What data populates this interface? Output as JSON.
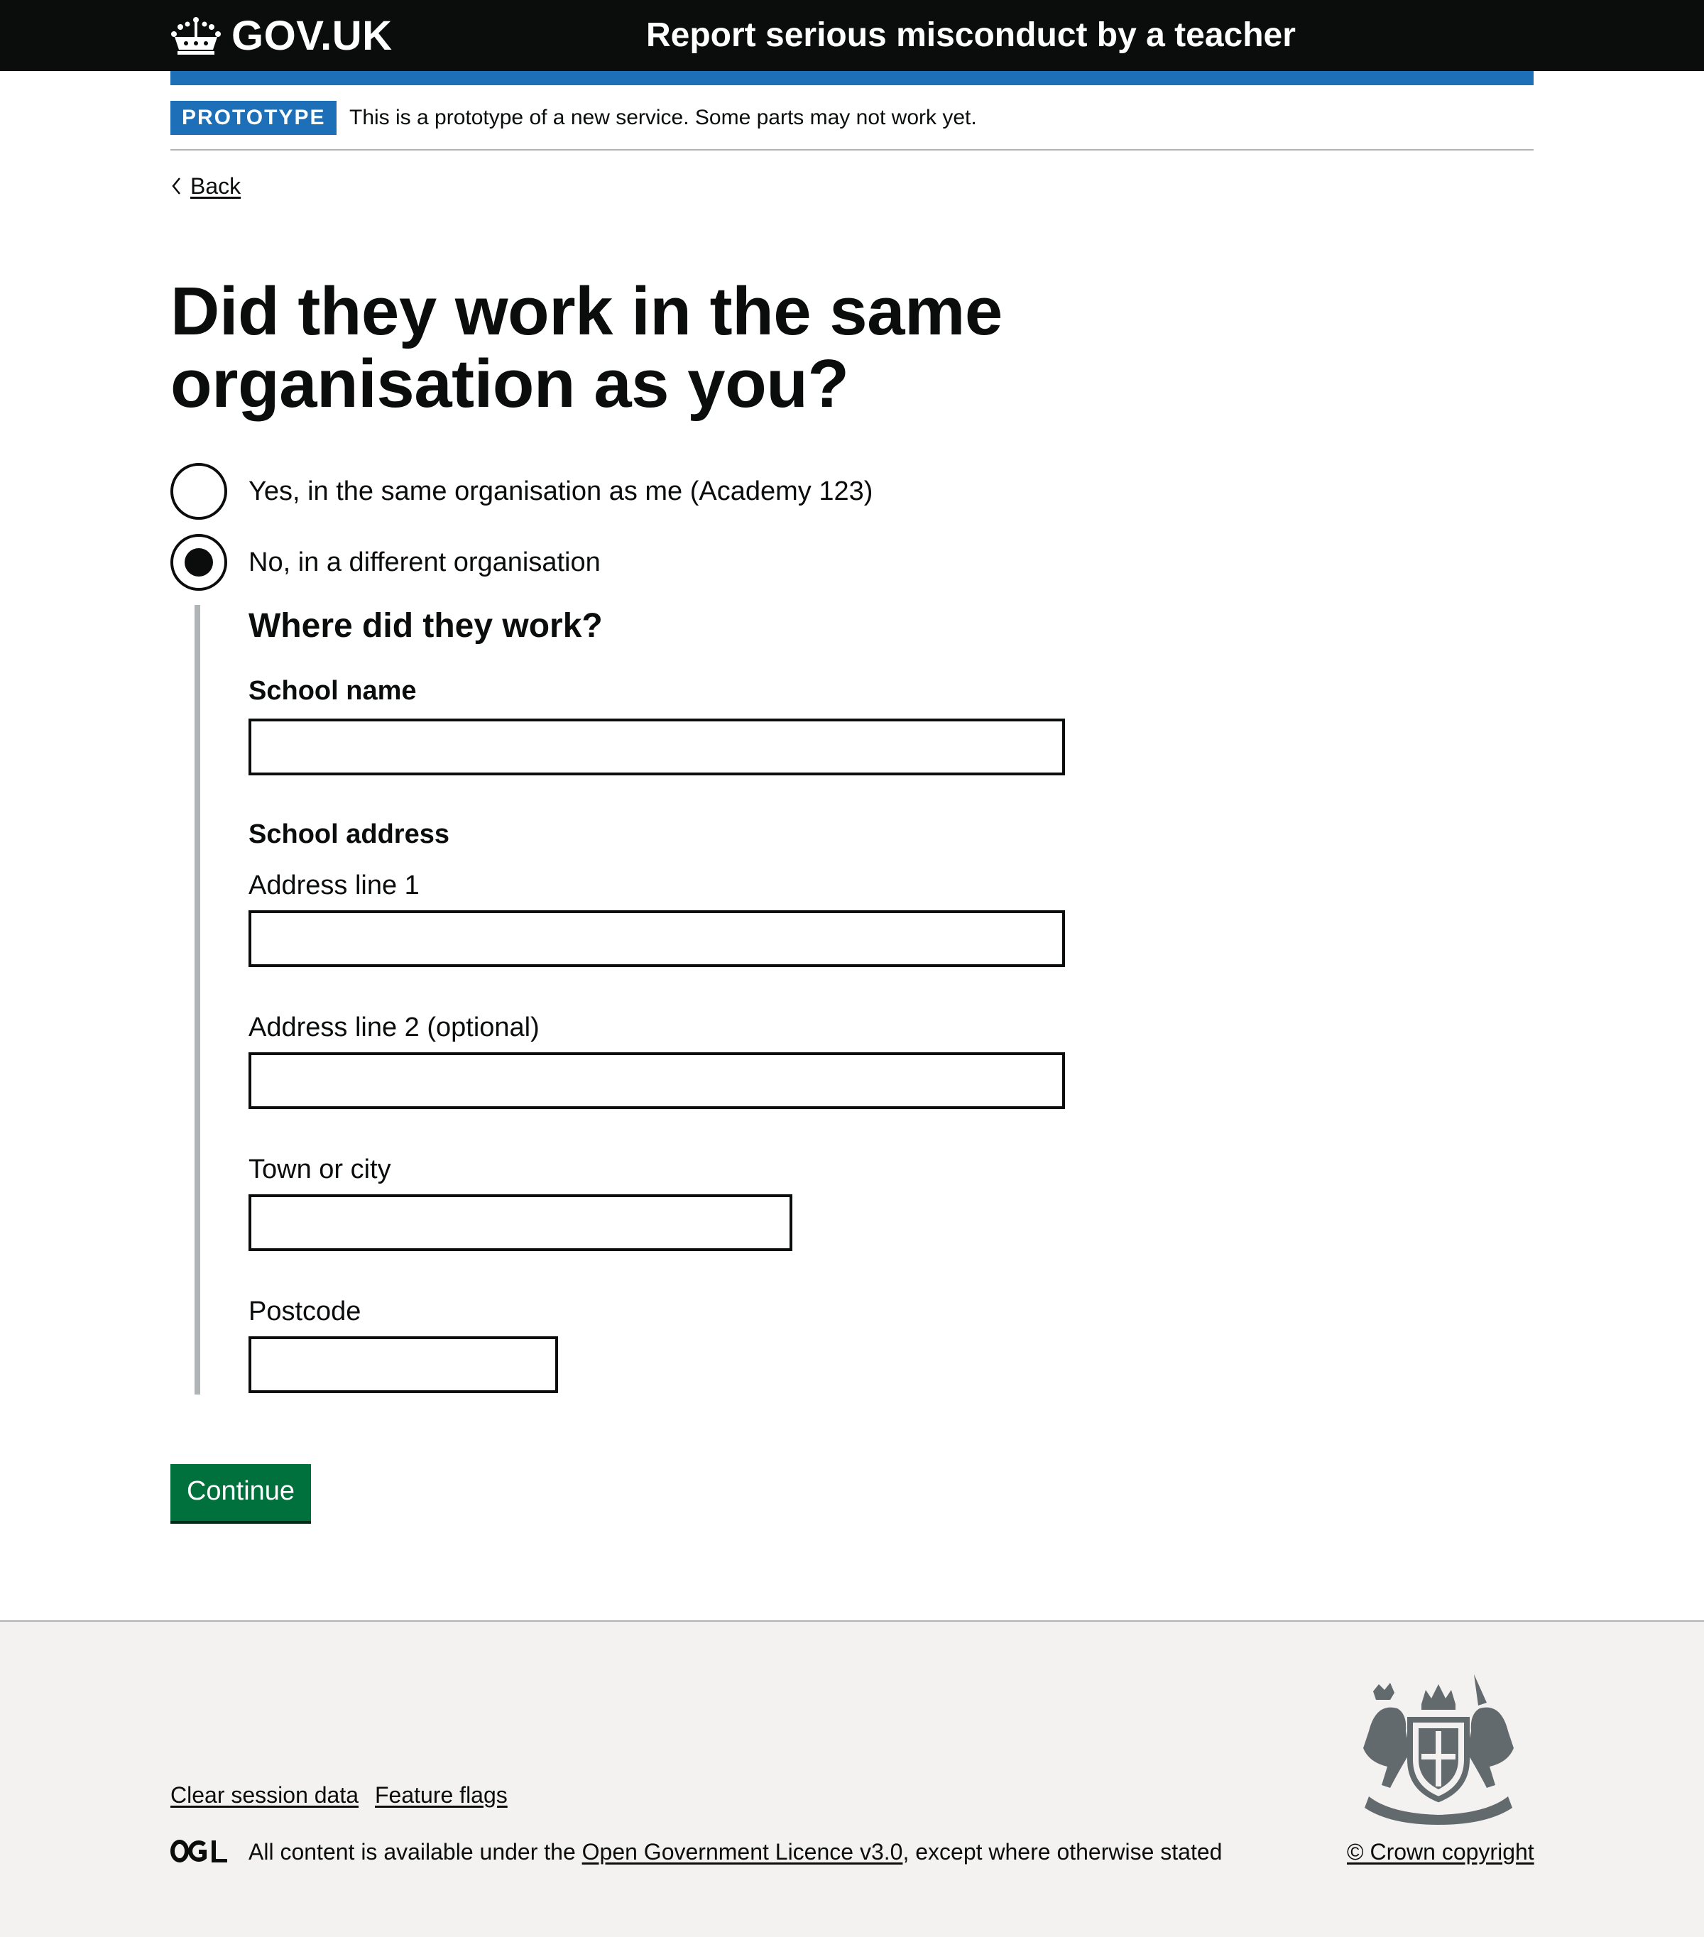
{
  "header": {
    "logo_text": "GOV.UK",
    "service_name": "Report serious misconduct by a teacher"
  },
  "phase_banner": {
    "tag": "PROTOTYPE",
    "text": "This is a prototype of a new service. Some parts may not work yet."
  },
  "back_link": {
    "label": "Back"
  },
  "question": {
    "heading_line1": "Did they work in the same",
    "heading_line2": "organisation as you?",
    "options": [
      {
        "label": "Yes, in the same organisation as me (Academy 123)",
        "checked": false
      },
      {
        "label": "No, in a different organisation",
        "checked": true
      }
    ]
  },
  "conditional": {
    "title": "Where did they work?",
    "school_name_label": "School name",
    "school_name_value": "",
    "school_address_label": "School address",
    "address_line1_label": "Address line 1",
    "address_line1_value": "",
    "address_line2_label": "Address line 2 (optional)",
    "address_line2_value": "",
    "town_label": "Town or city",
    "town_value": "",
    "postcode_label": "Postcode",
    "postcode_value": ""
  },
  "continue_button": {
    "label": "Continue"
  },
  "footer": {
    "links": [
      "Clear session data",
      "Feature flags"
    ],
    "licence_prefix": "All content is available under the ",
    "licence_link": "Open Government Licence v3.0",
    "licence_suffix": ", except where otherwise stated",
    "copyright": "© Crown copyright"
  },
  "colors": {
    "header_bg": "#0b0c0c",
    "brand_blue": "#1d70b8",
    "button_green": "#00703c",
    "footer_bg": "#f3f2f1",
    "border_grey": "#b1b4b6"
  },
  "icons": {
    "logo": "crown-icon",
    "back": "chevron-left-icon",
    "licence": "ogl-logo",
    "copyright": "royal-coat-of-arms"
  }
}
